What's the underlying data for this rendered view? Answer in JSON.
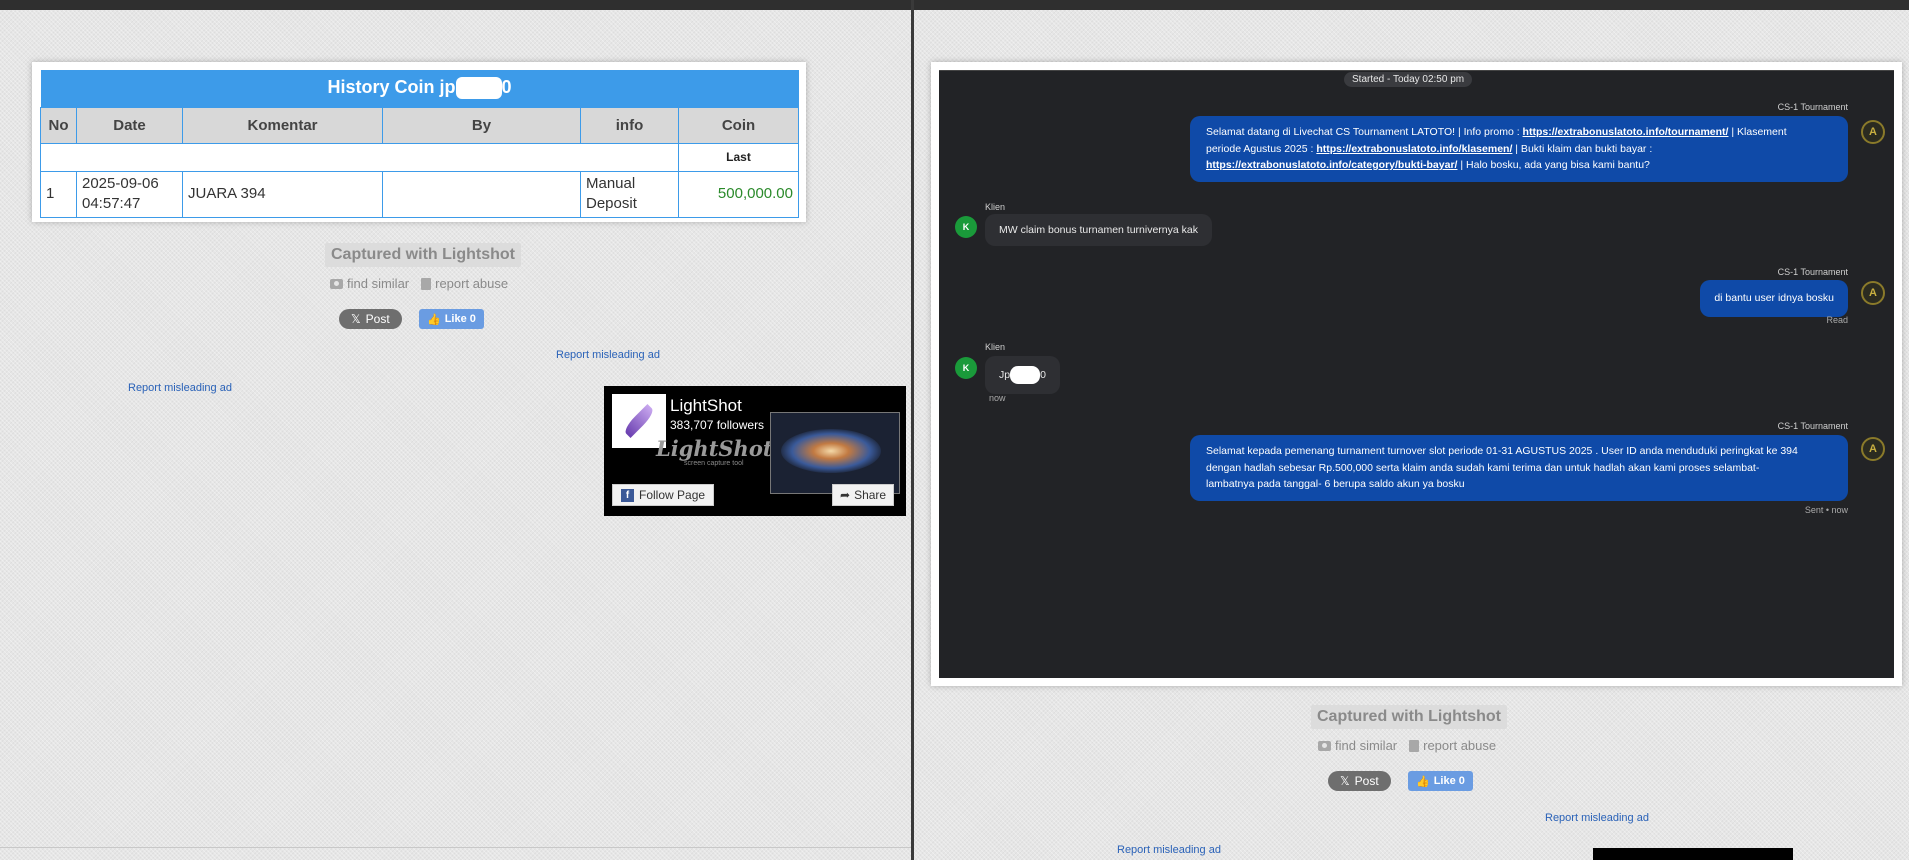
{
  "left": {
    "table": {
      "title_prefix": "History Coin jp",
      "title_suffix": "0",
      "columns": [
        "No",
        "Date",
        "Komentar",
        "By",
        "info",
        "Coin"
      ],
      "sub_label": "Last",
      "rows": [
        {
          "no": "1",
          "date_day": "2025-09-06",
          "date_time": "04:57:47",
          "komentar": "JUARA 394",
          "by": "",
          "info_1": "Manual",
          "info_2": "Deposit",
          "coin": "500,000.00"
        }
      ]
    },
    "captured": "Captured with Lightshot",
    "find_similar": "find similar",
    "report_abuse": "report abuse",
    "post_label": "Post",
    "like_label": "Like 0",
    "report_ad_1": "Report misleading ad",
    "report_ad_2": "Report misleading ad",
    "ad": {
      "name": "LightShot",
      "followers": "383,707 followers",
      "brand": "LightShot",
      "tagline": "screen capture tool",
      "follow_label": "Follow Page",
      "share_label": "Share"
    }
  },
  "right": {
    "chat": {
      "started": "Started - Today 02:50 pm",
      "messages": [
        {
          "sender": "CS-1 Tournament",
          "t1": "Selamat datang di Livechat CS Tournament LATOTO! | Info promo : ",
          "link1": "https://extrabonuslatoto.info/tournament/",
          "t2": " | Klasement",
          "t3": "periode Agustus 2025 : ",
          "link2": "https://extrabonuslatoto.info/klasemen/",
          "t4": " | Bukti klaim dan bukti bayar :",
          "link3": "https://extrabonuslatoto.info/category/bukti-bayar/",
          "t5": " | Halo bosku, ada yang bisa kami bantu?"
        },
        {
          "sender": "Klien",
          "avatar": "K",
          "text": "MW claim bonus turnamen turnivernya kak"
        },
        {
          "sender": "CS-1 Tournament",
          "text": "di bantu user idnya bosku",
          "status": "Read"
        },
        {
          "sender": "Klien",
          "avatar": "K",
          "text_prefix": "Jp",
          "text_suffix": "0",
          "time": "now"
        },
        {
          "sender": "CS-1 Tournament",
          "line1": "Selamat kepada pemenang turnament turnover slot periode 01-31 AGUSTUS 2025 . User ID anda menduduki peringkat ke 394",
          "line2": "dengan hadlah sebesar Rp.500,000 serta klaim anda sudah kami terima dan untuk hadlah akan kami proses selambat-",
          "line3": "lambatnya pada tanggal- 6 berupa saldo akun ya bosku",
          "status": "Sent • now"
        }
      ]
    },
    "captured": "Captured with Lightshot",
    "find_similar": "find similar",
    "report_abuse": "report abuse",
    "post_label": "Post",
    "like_label": "Like 0",
    "report_ad_1": "Report misleading ad",
    "report_ad_2": "Report misleading ad"
  },
  "icons": {
    "x": "x-logo-icon",
    "thumb": "thumbs-up-icon",
    "camera": "camera-icon",
    "flag": "document-icon",
    "facebook": "facebook-icon",
    "share": "share-arrow-icon",
    "avatar_agent": "A"
  }
}
